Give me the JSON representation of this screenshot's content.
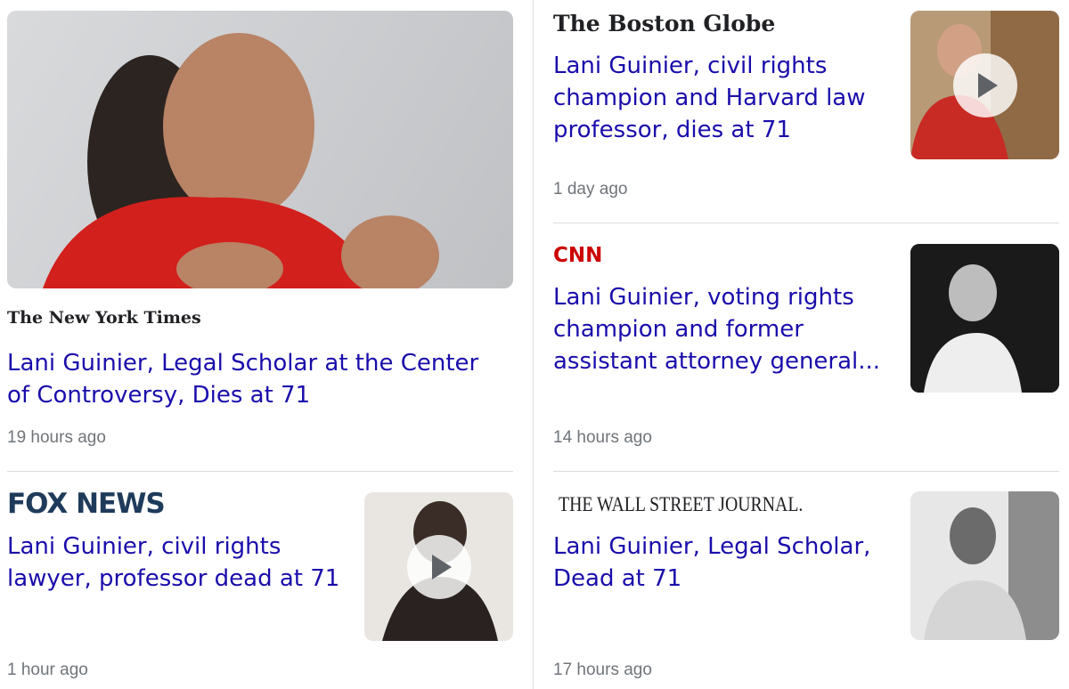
{
  "articles": [
    {
      "source": "The New York Times",
      "headline": "Lani Guinier, Legal Scholar at the Center of Controversy, Dies at 71",
      "time": "19 hours ago",
      "has_video": false
    },
    {
      "source": "The Boston Globe",
      "headline": "Lani Guinier, civil rights champion and Harvard law professor, dies at 71",
      "time": "1 day ago",
      "has_video": true
    },
    {
      "source": "CNN",
      "headline": "Lani Guinier, voting rights champion and former assistant attorney general...",
      "time": "14 hours ago",
      "has_video": false
    },
    {
      "source": "FOX NEWS",
      "headline": "Lani Guinier, civil rights lawyer, professor dead at 71",
      "time": "1 hour ago",
      "has_video": true
    },
    {
      "source": "THE WALL STREET JOURNAL.",
      "headline": "Lani Guinier, Legal Scholar, Dead at 71",
      "time": "17 hours ago",
      "has_video": false
    }
  ],
  "colors": {
    "headline": "#1a0dab",
    "meta": "#70757a",
    "divider": "#dadce0",
    "cnn_red": "#cc0000",
    "fox_navy": "#003366"
  }
}
